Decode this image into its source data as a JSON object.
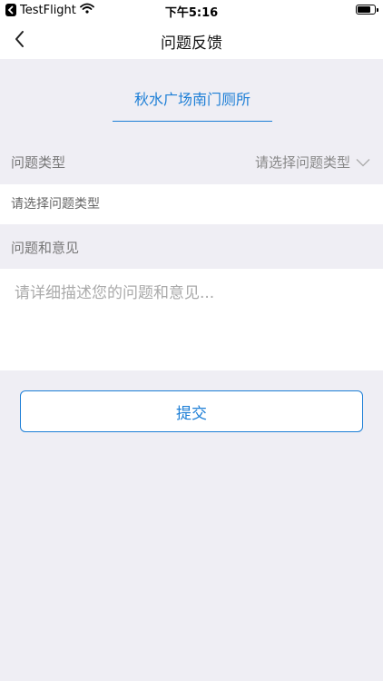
{
  "status_bar": {
    "app_name": "TestFlight",
    "time": "下午5:16",
    "battery_level_percent": 80
  },
  "nav": {
    "title": "问题反馈",
    "back_icon": "chevron-left-icon"
  },
  "location": {
    "name": "秋水广场南门厕所",
    "accent_color": "#1c7ed6"
  },
  "problem_type": {
    "label": "问题类型",
    "select_text": "请选择问题类型",
    "select_icon": "chevron-down-icon",
    "input_placeholder": "请选择问题类型"
  },
  "feedback": {
    "label": "问题和意见",
    "placeholder": "请详细描述您的问题和意见..."
  },
  "submit": {
    "label": "提交"
  }
}
